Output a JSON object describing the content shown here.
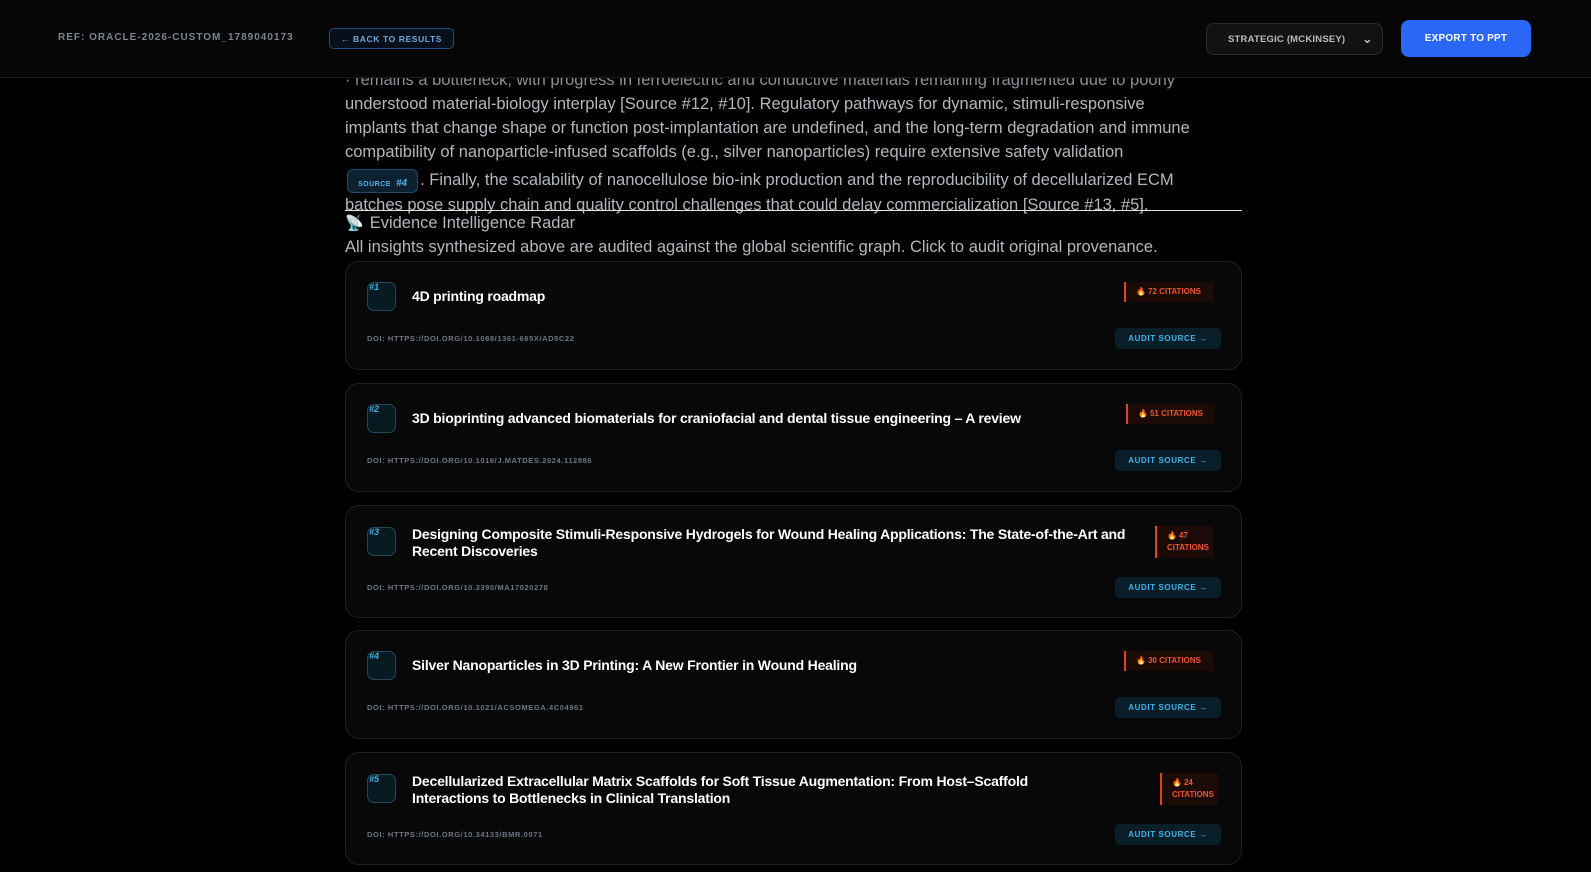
{
  "header": {
    "ref": "REF: ORACLE-2026-CUSTOM_1789040173",
    "back_label": "← BACK TO RESULTS",
    "mode_selected": "STRATEGIC (MCKINSEY)",
    "export_label": "EXPORT TO PPT"
  },
  "report": {
    "line0": "· remains a bottleneck, with progress in ferroelectric and conductive materials remaining fragmented due to poorly",
    "line1": "understood material-biology interplay [Source #12, #10]. Regulatory pathways for dynamic, stimuli-responsive",
    "line2": "implants that change shape or function post-implantation are undefined, and the long-term degradation and immune",
    "line3": "compatibility of nanoparticle-infused scaffolds (e.g., silver nanoparticles) require extensive safety validation",
    "source_chip_label": "SOURCE",
    "source_chip_num": "#4",
    "line4_rest": ". Finally, the scalability of nanocellulose bio-ink production and the reproducibility of decellularized ECM",
    "line5": "batches pose supply chain and quality control challenges that could delay commercialization [Source #13, #5]."
  },
  "radar": {
    "icon": "📡",
    "title": "Evidence Intelligence Radar",
    "subtitle": "All insights synthesized above are audited against the global scientific graph. Click to audit original provenance."
  },
  "sources": [
    {
      "rank": "#1",
      "title": "4D printing roadmap",
      "citations": "72 CITATIONS",
      "doi": "DOI: HTTPS://DOI.ORG/10.1088/1361-665X/AD5C22",
      "audit": "AUDIT SOURCE →"
    },
    {
      "rank": "#2",
      "title": "3D bioprinting advanced biomaterials for craniofacial and dental tissue engineering – A review",
      "citations": "51 CITATIONS",
      "doi": "DOI: HTTPS://DOI.ORG/10.1016/J.MATDES.2024.112886",
      "audit": "AUDIT SOURCE →"
    },
    {
      "rank": "#3",
      "title": "Designing Composite Stimuli-Responsive Hydrogels for Wound Healing Applications: The State-of-the-Art and Recent Discoveries",
      "citations": "47 CITATIONS",
      "doi": "DOI: HTTPS://DOI.ORG/10.3390/MA17020278",
      "audit": "AUDIT SOURCE →"
    },
    {
      "rank": "#4",
      "title": "Silver Nanoparticles in 3D Printing: A New Frontier in Wound Healing",
      "citations": "30 CITATIONS",
      "doi": "DOI: HTTPS://DOI.ORG/10.1021/ACSOMEGA.4C04961",
      "audit": "AUDIT SOURCE →"
    },
    {
      "rank": "#5",
      "title": "Decellularized Extracellular Matrix Scaffolds for Soft Tissue Augmentation: From Host–Scaffold Interactions to Bottlenecks in Clinical Translation",
      "citations": "24 CITATIONS",
      "doi": "DOI: HTTPS://DOI.ORG/10.34133/BMR.0071",
      "audit": "AUDIT SOURCE →"
    }
  ]
}
